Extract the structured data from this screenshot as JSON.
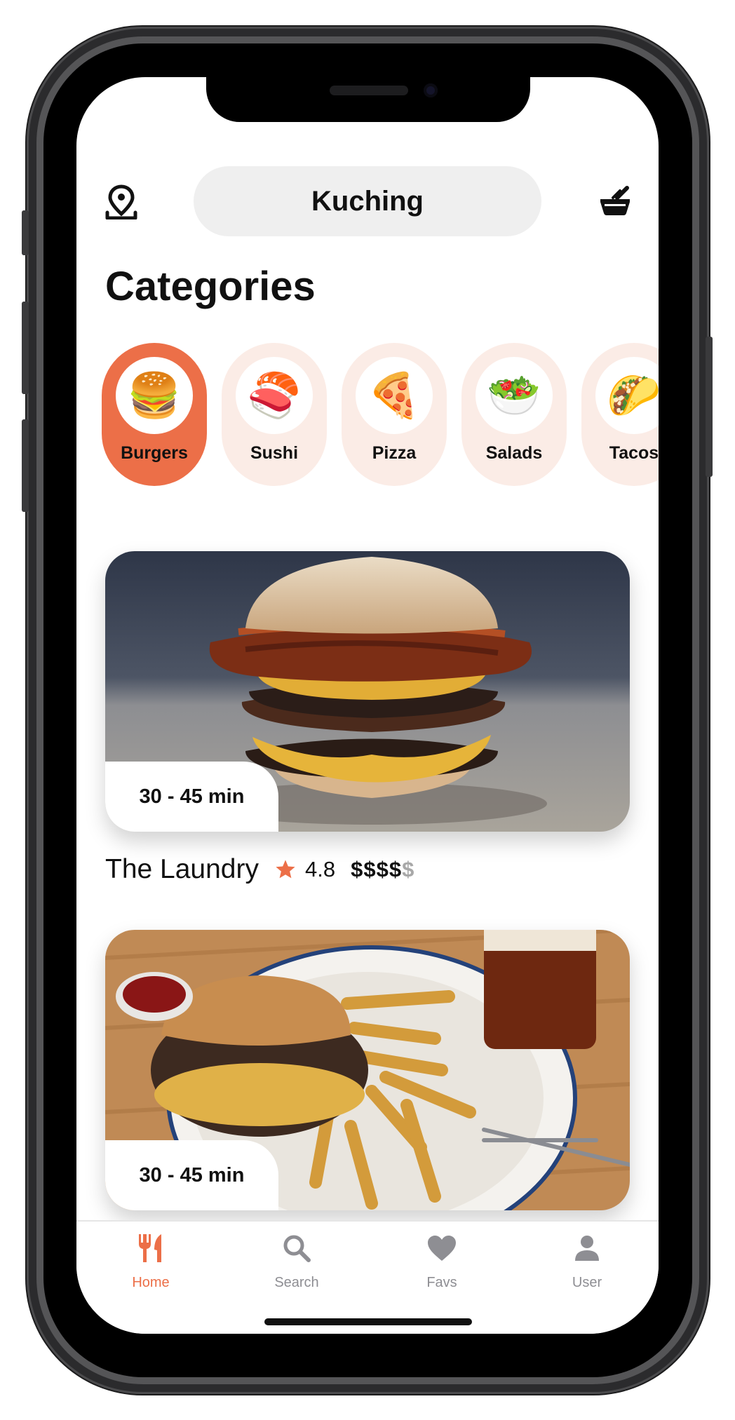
{
  "header": {
    "location": "Kuching"
  },
  "categories": {
    "title": "Categories",
    "items": [
      {
        "label": "Burgers",
        "emoji": "🍔",
        "active": true
      },
      {
        "label": "Sushi",
        "emoji": "🍣",
        "active": false
      },
      {
        "label": "Pizza",
        "emoji": "🍕",
        "active": false
      },
      {
        "label": "Salads",
        "emoji": "🥗",
        "active": false
      },
      {
        "label": "Tacos",
        "emoji": "🌮",
        "active": false
      }
    ]
  },
  "restaurants": [
    {
      "eta": "30 - 45 min",
      "name": "The Laundry",
      "rating": "4.8",
      "price_active": "$$$$",
      "price_inactive": "$"
    },
    {
      "eta": "30 - 45 min"
    }
  ],
  "tabbar": {
    "items": [
      {
        "label": "Home",
        "icon": "fork-knife-icon",
        "active": true
      },
      {
        "label": "Search",
        "icon": "search-icon",
        "active": false
      },
      {
        "label": "Favs",
        "icon": "heart-icon",
        "active": false
      },
      {
        "label": "User",
        "icon": "user-icon",
        "active": false
      }
    ]
  },
  "colors": {
    "accent": "#ec6f48",
    "accent_light": "#fbece6",
    "pill_bg": "#efefef",
    "muted": "#8e8e93"
  }
}
